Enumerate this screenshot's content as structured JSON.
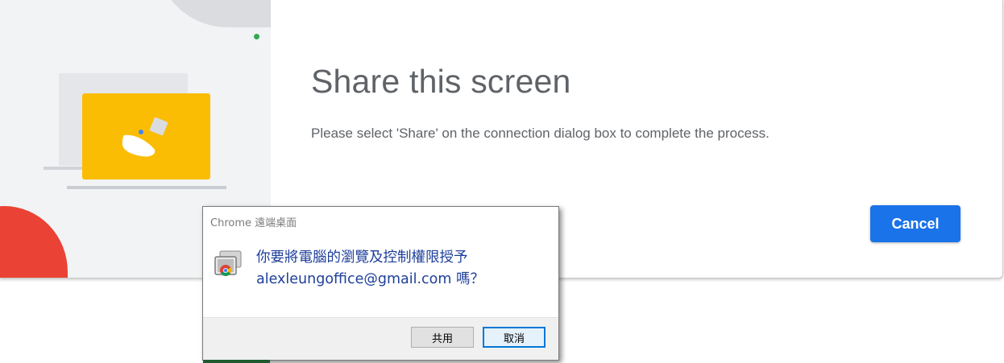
{
  "colors": {
    "accent_blue": "#1a73e8",
    "illustration_yellow": "#fbbc04",
    "illustration_red": "#ea4335",
    "illustration_green": "#34a853",
    "dialog_text_blue": "#1e3f9a"
  },
  "share_panel": {
    "title": "Share this screen",
    "message": "Please select 'Share' on the connection dialog box to complete the process.",
    "cancel_label": "Cancel"
  },
  "dialog": {
    "title": "Chrome 遠端桌面",
    "icon": "chrome-remote-desktop-icon",
    "message_line1": "你要將電腦的瀏覽及控制權限授予",
    "message_line2": "alexleungoffice@gmail.com 嗎？",
    "share_label": "共用",
    "cancel_label": "取消"
  }
}
